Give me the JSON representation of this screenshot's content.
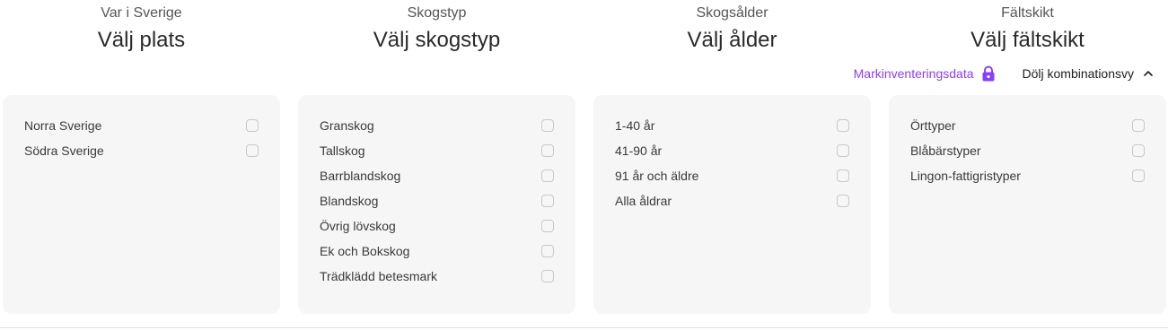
{
  "filters": [
    {
      "subtitle": "Var i Sverige",
      "title": "Välj plats",
      "options": [
        "Norra Sverige",
        "Södra Sverige"
      ]
    },
    {
      "subtitle": "Skogstyp",
      "title": "Välj skogstyp",
      "options": [
        "Granskog",
        "Tallskog",
        "Barrblandskog",
        "Blandskog",
        "Övrig lövskog",
        "Ek och Bokskog",
        "Trädklädd betesmark"
      ]
    },
    {
      "subtitle": "Skogsålder",
      "title": "Välj ålder",
      "options": [
        "1-40 år",
        "41-90 år",
        "91 år och äldre",
        "Alla åldrar"
      ]
    },
    {
      "subtitle": "Fältskikt",
      "title": "Välj fältskikt",
      "options": [
        "Örttyper",
        "Blåbärstyper",
        "Lingon-fattigristyper"
      ]
    }
  ],
  "toolbar": {
    "markinventering_label": "Markinventeringsdata",
    "toggle_label": "Dölj kombinationsvy"
  },
  "colors": {
    "accent": "#8a3ffc",
    "panel_bg": "#f6f6f6"
  },
  "icons": {
    "lock": "lock-icon",
    "chevron": "chevron-up-icon"
  }
}
